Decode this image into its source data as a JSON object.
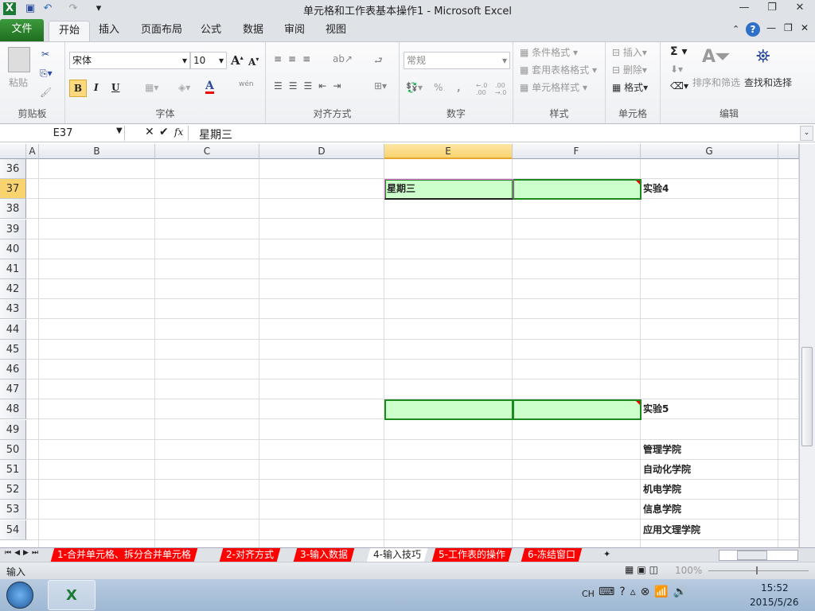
{
  "window": {
    "title": "单元格和工作表基本操作1  -  Microsoft Excel"
  },
  "ribbon_tabs": [
    "文件",
    "开始",
    "插入",
    "页面布局",
    "公式",
    "数据",
    "审阅",
    "视图"
  ],
  "clipboard": {
    "paste": "粘贴",
    "label": "剪贴板"
  },
  "font": {
    "name": "宋体",
    "size": "10",
    "bold": "B",
    "italic": "I",
    "underline": "U",
    "color": "A",
    "phonetic": "wén",
    "label": "字体"
  },
  "alignment": {
    "label": "对齐方式"
  },
  "number": {
    "format": "常规",
    "percent": "%",
    "comma": ",",
    "inc": "←.0 .00",
    "dec": ".00 →.0",
    "label": "数字"
  },
  "styles": {
    "conditional": "条件格式",
    "table": "套用表格格式",
    "cell": "单元格样式",
    "label": "样式"
  },
  "cells": {
    "insert": "插入",
    "delete": "删除",
    "format": "格式",
    "label": "单元格"
  },
  "editing": {
    "sum": "Σ",
    "sort": "排序和筛选",
    "find": "查找和选择",
    "label": "编辑"
  },
  "formula_bar": {
    "name_box": "E37",
    "fx": "fx",
    "value": "星期三"
  },
  "columns": [
    "A",
    "B",
    "C",
    "D",
    "E",
    "F",
    "G"
  ],
  "selected_column": "E",
  "rows": [
    "36",
    "37",
    "38",
    "39",
    "40",
    "41",
    "42",
    "43",
    "44",
    "45",
    "46",
    "47",
    "48",
    "49",
    "50",
    "51",
    "52",
    "53",
    "54"
  ],
  "selected_row": "37",
  "cell_values": {
    "E37": "星期三",
    "G37": "实验4",
    "G48": "实验5",
    "G50": "管理学院",
    "G51": "自动化学院",
    "G52": "机电学院",
    "G53": "信息学院",
    "G54": "应用文理学院"
  },
  "sheet_tabs": [
    "1-合并单元格、拆分合并单元格",
    "2-对齐方式",
    "3-输入数据",
    "4-输入技巧",
    "5-工作表的操作",
    "6-冻结窗口"
  ],
  "active_sheet": "4-输入技巧",
  "status": {
    "mode": "输入",
    "zoom": "100%"
  },
  "taskbar": {
    "lang": "CH",
    "time": "15:52",
    "date": "2015/5/26"
  },
  "colors": {
    "fill_green": "#ccffcc",
    "border_green": "#1e8a1e",
    "tab_red": "#ff0000",
    "file_tab": "#2a7f2a"
  }
}
